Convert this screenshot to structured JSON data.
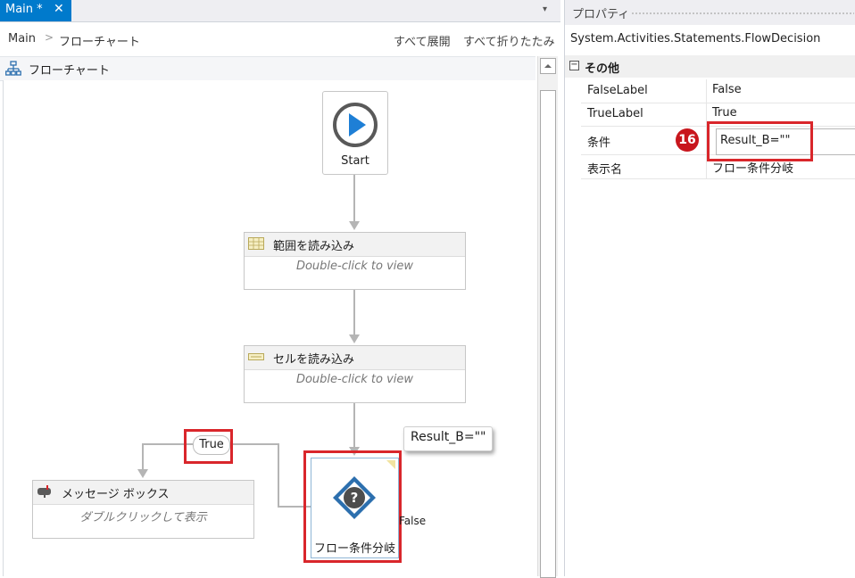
{
  "designer": {
    "tab_title": "Main *",
    "tab_close": "✕",
    "tab_menu": "▾",
    "breadcrumb": [
      "Main",
      "フローチャート"
    ],
    "breadcrumb_sep": ">",
    "expand_all": "すべて展開",
    "collapse_all": "すべて折りたたみ",
    "canvas_title": "フローチャート"
  },
  "nodes": {
    "start_label": "Start",
    "read_range": {
      "title": "範囲を読み込み",
      "body": "Double-click to view"
    },
    "read_cell": {
      "title": "セルを読み込み",
      "body": "Double-click to view"
    },
    "message_box": {
      "title": "メッセージ ボックス",
      "body": "ダブルクリックして表示"
    },
    "decision": {
      "label": "フロー条件分岐",
      "tooltip": "Result_B=\"\""
    },
    "true_label": "True",
    "false_label": "False"
  },
  "properties": {
    "panel_title": "プロパティ",
    "type_name": "System.Activities.Statements.FlowDecision",
    "category": "その他",
    "category_toggle": "−",
    "rows": [
      {
        "name": "FalseLabel",
        "value": "False"
      },
      {
        "name": "TrueLabel",
        "value": "True"
      },
      {
        "name": "条件",
        "value": ""
      },
      {
        "name": "表示名",
        "value": "フロー条件分岐"
      }
    ],
    "condition_value": "Result_B=\"\"",
    "step_badge": "16"
  },
  "colors": {
    "accent": "#007acc",
    "highlight": "#d9262b",
    "badge": "#c8161d",
    "decision_blue": "#2c6fae",
    "play_blue": "#1e7fd6"
  }
}
